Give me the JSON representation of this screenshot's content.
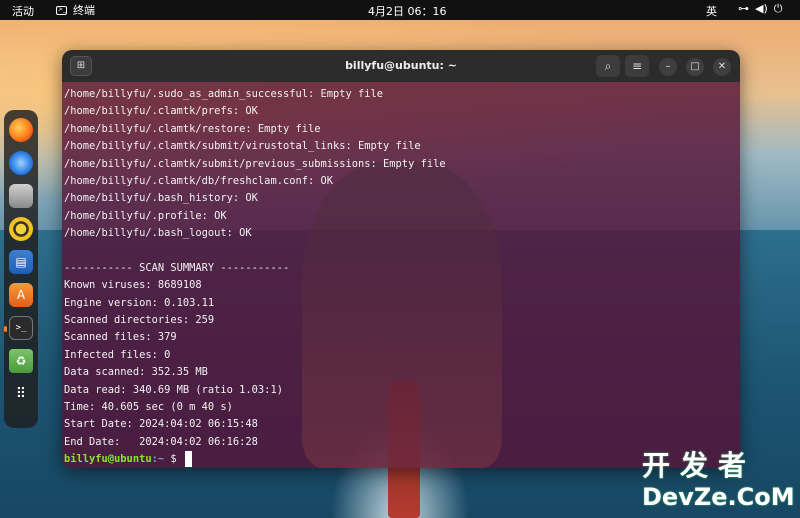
{
  "topbar": {
    "activities": "活动",
    "app_name": "终端",
    "clock": "4月2日  06：16",
    "language": "英",
    "tray_icons": [
      "network-icon",
      "volume-icon",
      "power-icon"
    ]
  },
  "dock": {
    "items": [
      {
        "name": "firefox",
        "icon": "firefox-icon"
      },
      {
        "name": "thunderbird",
        "icon": "thunderbird-icon"
      },
      {
        "name": "files",
        "icon": "files-icon"
      },
      {
        "name": "rhythmbox",
        "icon": "rhythmbox-icon"
      },
      {
        "name": "libreoffice-writer",
        "icon": "writer-icon"
      },
      {
        "name": "app-center",
        "icon": "store-icon"
      },
      {
        "name": "terminal",
        "icon": "terminal-icon",
        "active": true
      },
      {
        "name": "trash",
        "icon": "trash-icon"
      },
      {
        "name": "show-apps",
        "icon": "apps-grid-icon"
      }
    ]
  },
  "window": {
    "title": "billyfu@ubuntu: ~",
    "prompt_user": "billyfu@ubuntu",
    "prompt_path": ":~",
    "prompt_symbol": "$",
    "lines": [
      "/home/billyfu/.sudo_as_admin_successful: Empty file",
      "/home/billyfu/.clamtk/prefs: OK",
      "/home/billyfu/.clamtk/restore: Empty file",
      "/home/billyfu/.clamtk/submit/virustotal_links: Empty file",
      "/home/billyfu/.clamtk/submit/previous_submissions: Empty file",
      "/home/billyfu/.clamtk/db/freshclam.conf: OK",
      "/home/billyfu/.bash_history: OK",
      "/home/billyfu/.profile: OK",
      "/home/billyfu/.bash_logout: OK",
      "",
      "----------- SCAN SUMMARY -----------",
      "Known viruses: 8689108",
      "Engine version: 0.103.11",
      "Scanned directories: 259",
      "Scanned files: 379",
      "Infected files: 0",
      "Data scanned: 352.35 MB",
      "Data read: 340.69 MB (ratio 1.03:1)",
      "Time: 40.605 sec (0 m 40 s)",
      "Start Date: 2024:04:02 06:15:48",
      "End Date:   2024:04:02 06:16:28"
    ]
  },
  "watermark": {
    "cn": "开发者",
    "en": "DevZe.CoM"
  }
}
